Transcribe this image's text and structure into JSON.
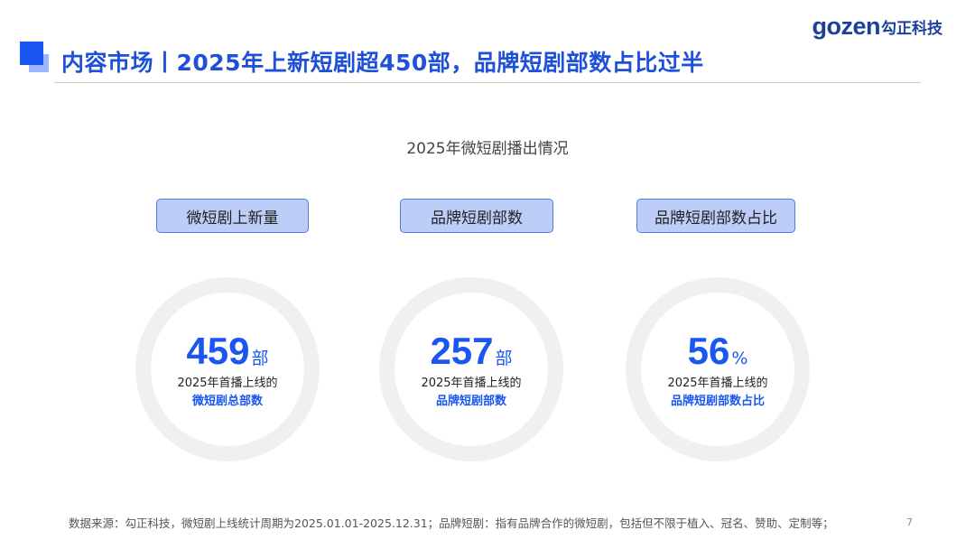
{
  "logo": {
    "mark": "gozen",
    "cn": "勾正科技"
  },
  "header": {
    "title": "内容市场丨2025年上新短剧超450部，品牌短剧部数占比过半"
  },
  "section": {
    "title": "2025年微短剧播出情况"
  },
  "stats": [
    {
      "label": "微短剧上新量",
      "value": "459",
      "unit": "部",
      "desc": "2025年首播上线的",
      "highlight": "微短剧总部数"
    },
    {
      "label": "品牌短剧部数",
      "value": "257",
      "unit": "部",
      "desc": "2025年首播上线的",
      "highlight": "品牌短剧部数"
    },
    {
      "label": "品牌短剧部数占比",
      "value": "56",
      "unit": "%",
      "desc": "2025年首播上线的",
      "highlight": "品牌短剧部数占比"
    }
  ],
  "footer": {
    "source": "数据来源：勾正科技，微短剧上线统计周期为2025.01.01-2025.12.31；品牌短剧：指有品牌合作的微短剧，包括但不限于植入、冠名、赞助、定制等；",
    "page": "7"
  },
  "colors": {
    "accent": "#1a56f0",
    "accent_light": "#bccdf8",
    "ring": "#f0f0f0",
    "logo": "#1b3f9a"
  }
}
